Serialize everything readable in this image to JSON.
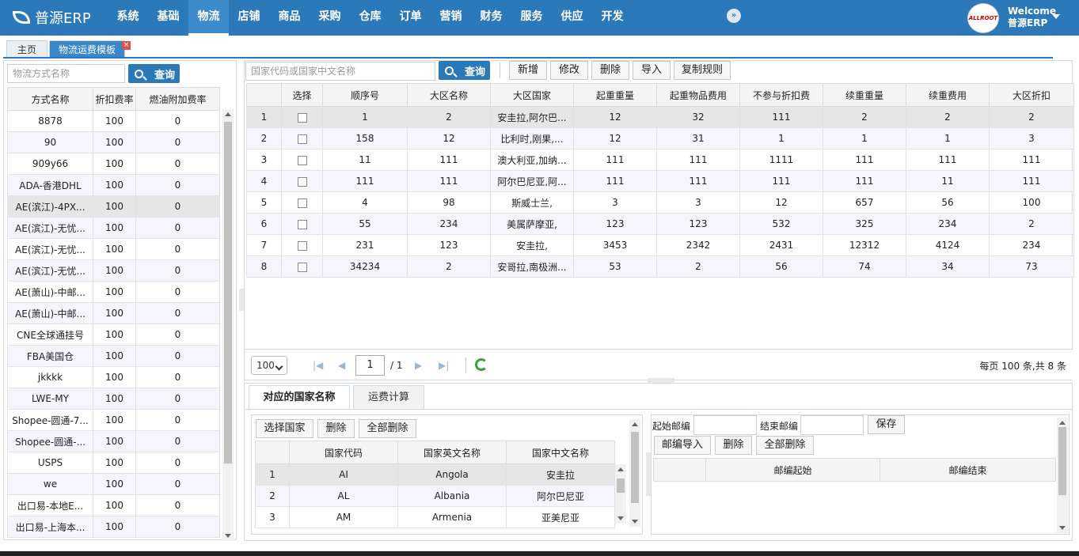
{
  "app": {
    "name": "普源ERP",
    "welcome": "Welcome",
    "user": "普源ERP",
    "avatar_text": "ALLROOT"
  },
  "nav": [
    "系统",
    "基础",
    "物流",
    "店铺",
    "商品",
    "采购",
    "仓库",
    "订单",
    "营销",
    "财务",
    "服务",
    "供应",
    "开发"
  ],
  "tabs": {
    "home": "主页",
    "current": "物流运费模板",
    "close": "×"
  },
  "left": {
    "search_placeholder": "物流方式名称",
    "query": "查询",
    "columns": [
      "方式名称",
      "折扣费率",
      "燃油附加费率"
    ],
    "rows": [
      [
        "8878",
        "100",
        "0"
      ],
      [
        "90",
        "100",
        "0"
      ],
      [
        "909y66",
        "100",
        "0"
      ],
      [
        "ADA-香港DHL",
        "100",
        "0"
      ],
      [
        "AE(滨江)-4PX...",
        "100",
        "0"
      ],
      [
        "AE(滨江)-无忧...",
        "100",
        "0"
      ],
      [
        "AE(滨江)-无忧...",
        "100",
        "0"
      ],
      [
        "AE(滨江)-无忧...",
        "100",
        "0"
      ],
      [
        "AE(萧山)-中邮...",
        "100",
        "0"
      ],
      [
        "AE(萧山)-中邮...",
        "100",
        "0"
      ],
      [
        "CNE全球通挂号",
        "100",
        "0"
      ],
      [
        "FBA美国仓",
        "100",
        "0"
      ],
      [
        "jkkkk",
        "100",
        "0"
      ],
      [
        "LWE-MY",
        "100",
        "0"
      ],
      [
        "Shopee-圆通-7...",
        "100",
        "0"
      ],
      [
        "Shopee-圆通-...",
        "100",
        "0"
      ],
      [
        "USPS",
        "100",
        "0"
      ],
      [
        "we",
        "100",
        "0"
      ],
      [
        "出口易-本地E...",
        "100",
        "0"
      ],
      [
        "出口易-上海本...",
        "100",
        "0"
      ]
    ]
  },
  "main": {
    "search_placeholder": "国家代码或国家中文名称",
    "query": "查询",
    "toolbar": [
      "新增",
      "修改",
      "删除",
      "导入",
      "复制规则"
    ],
    "columns": [
      "",
      "选择",
      "顺序号",
      "大区名称",
      "大区国家",
      "起重重量",
      "起重物品费用",
      "不参与折扣费",
      "续重重量",
      "续重费用",
      "大区折扣"
    ],
    "rows": [
      [
        "1",
        "",
        "1",
        "2",
        "安圭拉,阿尔巴...",
        "12",
        "32",
        "111",
        "2",
        "2",
        "2"
      ],
      [
        "2",
        "",
        "158",
        "12",
        "比利时,刚果,...",
        "12",
        "31",
        "1",
        "1",
        "1",
        "3"
      ],
      [
        "3",
        "",
        "11",
        "111",
        "澳大利亚,加纳...",
        "111",
        "111",
        "1111",
        "111",
        "111",
        "111"
      ],
      [
        "4",
        "",
        "111",
        "111",
        "阿尔巴尼亚,阿...",
        "111",
        "111",
        "111",
        "111",
        "11",
        "111"
      ],
      [
        "5",
        "",
        "4",
        "98",
        "斯威士兰,",
        "3",
        "3",
        "12",
        "657",
        "56",
        "100"
      ],
      [
        "6",
        "",
        "55",
        "234",
        "美属萨摩亚,",
        "123",
        "123",
        "532",
        "325",
        "234",
        "2"
      ],
      [
        "7",
        "",
        "231",
        "123",
        "安圭拉,",
        "3453",
        "2342",
        "2431",
        "12312",
        "4124",
        "234"
      ],
      [
        "8",
        "",
        "34234",
        "2",
        "安哥拉,南极洲...",
        "53",
        "2",
        "56",
        "74",
        "34",
        "73"
      ]
    ],
    "pager": {
      "size": "100",
      "page": "1",
      "total": "/ 1",
      "info": "每页 100 条,共 8 条"
    }
  },
  "bottom": {
    "tabs": [
      "对应的国家名称",
      "运费计算"
    ],
    "country_toolbar": [
      "选择国家",
      "删除",
      "全部删除"
    ],
    "country_columns": [
      "",
      "国家代码",
      "国家英文名称",
      "国家中文名称"
    ],
    "country_rows": [
      [
        "1",
        "AI",
        "Angola",
        "安圭拉"
      ],
      [
        "2",
        "AL",
        "Albania",
        "阿尔巴尼亚"
      ],
      [
        "3",
        "AM",
        "Armenia",
        "亚美尼亚"
      ]
    ],
    "zip_start_label": "起始邮编",
    "zip_end_label": "结束邮编",
    "save": "保存",
    "zip_toolbar": [
      "邮编导入",
      "删除",
      "全部删除"
    ],
    "zip_columns": [
      "",
      "邮编起始",
      "邮编结束"
    ]
  }
}
